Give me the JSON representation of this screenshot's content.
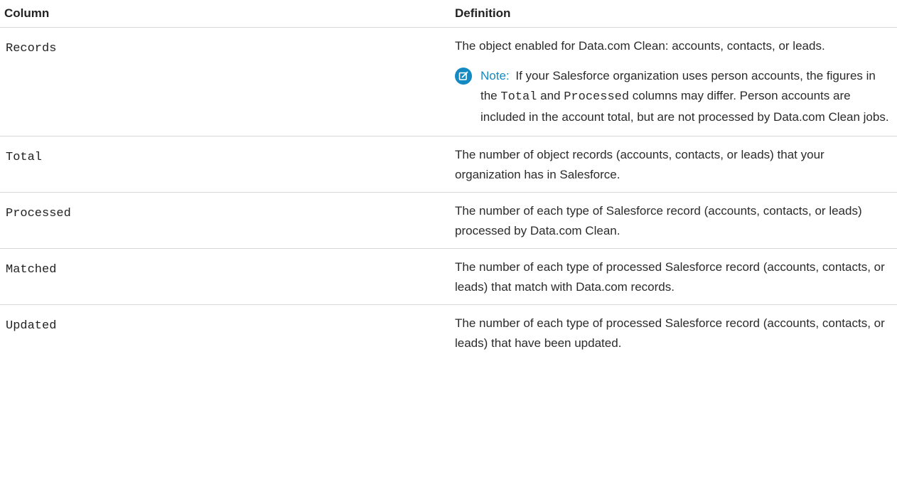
{
  "table": {
    "headers": {
      "column": "Column",
      "definition": "Definition"
    },
    "rows": [
      {
        "term": "Records",
        "definition": "The object enabled for Data.com Clean: accounts, contacts, or leads.",
        "note": {
          "icon": "note-edit-icon",
          "label": "Note:",
          "text_before": "If your Salesforce organization uses person accounts, the figures in the",
          "code_1": "Total",
          "text_middle": "and",
          "code_2": "Processed",
          "text_after": "columns may differ. Person accounts are included in the account total, but are not processed by Data.com Clean jobs."
        }
      },
      {
        "term": "Total",
        "definition": "The number of object records (accounts, contacts, or leads) that your organization has in Salesforce."
      },
      {
        "term": "Processed",
        "definition": "The number of each type of Salesforce record (accounts, contacts, or leads) processed by Data.com Clean."
      },
      {
        "term": "Matched",
        "definition": "The number of each type of processed Salesforce record (accounts, contacts, or leads) that match with Data.com records."
      },
      {
        "term": "Updated",
        "definition": "The number of each type of processed Salesforce record (accounts, contacts, or leads) that have been updated."
      }
    ]
  },
  "colors": {
    "note_accent": "#1589c2",
    "text": "#222222",
    "row_border": "#d8d8d8"
  }
}
